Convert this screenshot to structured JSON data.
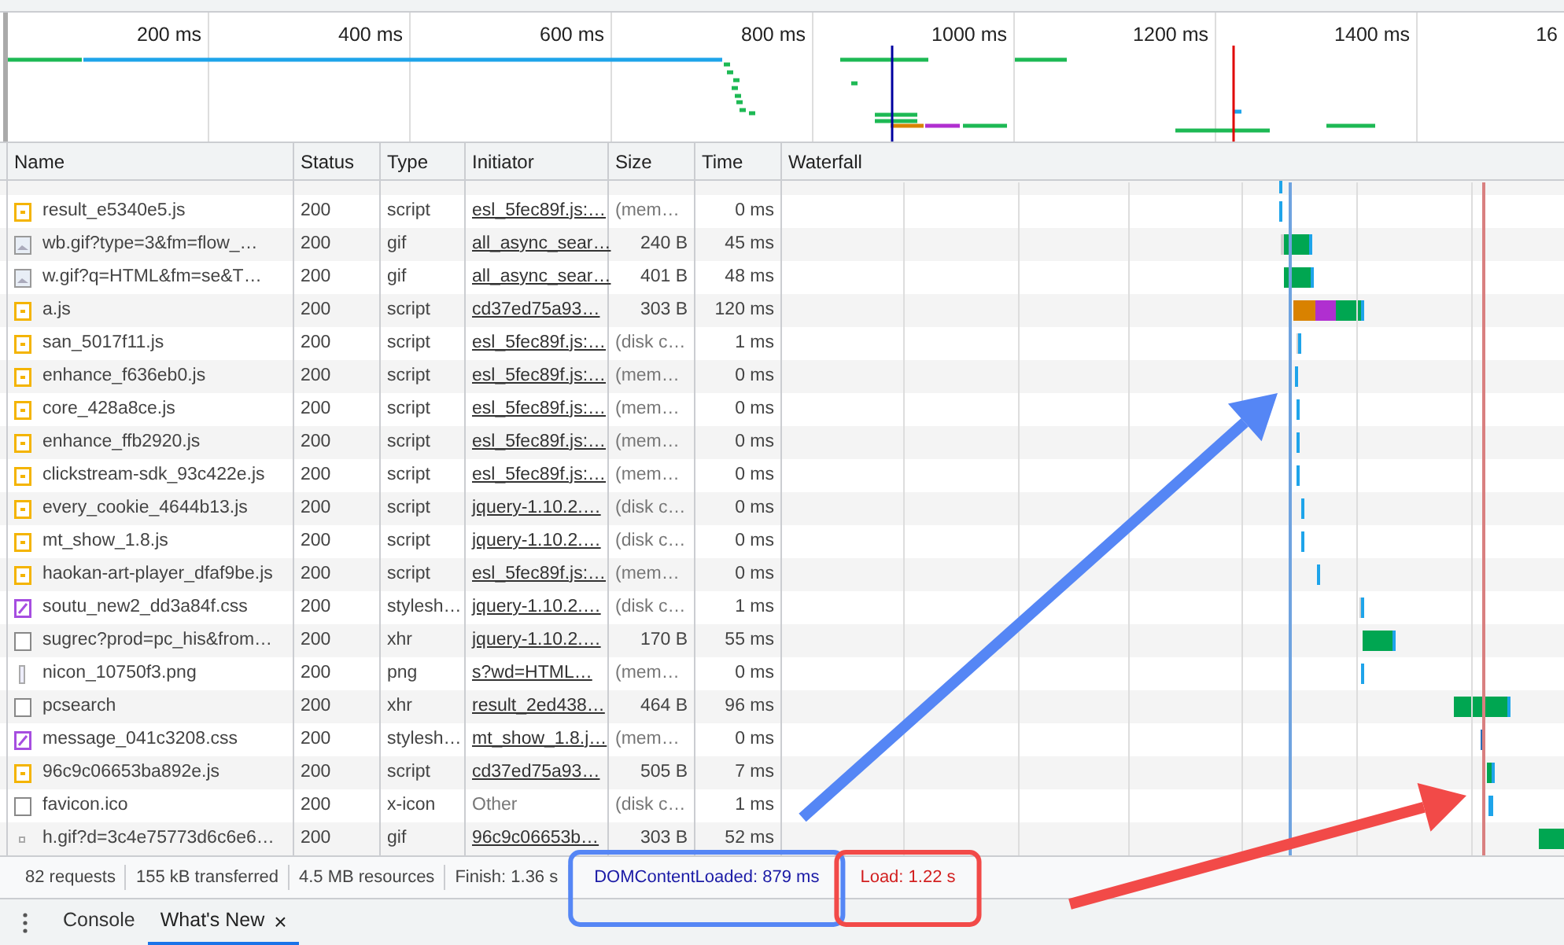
{
  "overview": {
    "ticks": [
      "200 ms",
      "400 ms",
      "600 ms",
      "800 ms",
      "1000 ms",
      "1200 ms",
      "1400 ms",
      "16"
    ]
  },
  "columns": [
    "Name",
    "Status",
    "Type",
    "Initiator",
    "Size",
    "Time",
    "Waterfall"
  ],
  "rows": [
    {
      "kind": "script",
      "name": "result_e5340e5.js",
      "status": "200",
      "type": "script",
      "initiator": "esl_5fec89f.js:…",
      "link": true,
      "size": "(mem…",
      "cached": true,
      "time": "0 ms"
    },
    {
      "kind": "image",
      "name": "wb.gif?type=3&fm=flow_…",
      "status": "200",
      "type": "gif",
      "initiator": "all_async_sear…",
      "link": true,
      "size": "240 B",
      "cached": false,
      "time": "45 ms"
    },
    {
      "kind": "image",
      "name": "w.gif?q=HTML&fm=se&T…",
      "status": "200",
      "type": "gif",
      "initiator": "all_async_sear…",
      "link": true,
      "size": "401 B",
      "cached": false,
      "time": "48 ms"
    },
    {
      "kind": "script",
      "name": "a.js",
      "status": "200",
      "type": "script",
      "initiator": "cd37ed75a93…",
      "link": true,
      "size": "303 B",
      "cached": false,
      "time": "120 ms"
    },
    {
      "kind": "script",
      "name": "san_5017f11.js",
      "status": "200",
      "type": "script",
      "initiator": "esl_5fec89f.js:…",
      "link": true,
      "size": "(disk c…",
      "cached": true,
      "time": "1 ms"
    },
    {
      "kind": "script",
      "name": "enhance_f636eb0.js",
      "status": "200",
      "type": "script",
      "initiator": "esl_5fec89f.js:…",
      "link": true,
      "size": "(mem…",
      "cached": true,
      "time": "0 ms"
    },
    {
      "kind": "script",
      "name": "core_428a8ce.js",
      "status": "200",
      "type": "script",
      "initiator": "esl_5fec89f.js:…",
      "link": true,
      "size": "(mem…",
      "cached": true,
      "time": "0 ms"
    },
    {
      "kind": "script",
      "name": "enhance_ffb2920.js",
      "status": "200",
      "type": "script",
      "initiator": "esl_5fec89f.js:…",
      "link": true,
      "size": "(mem…",
      "cached": true,
      "time": "0 ms"
    },
    {
      "kind": "script",
      "name": "clickstream-sdk_93c422e.js",
      "status": "200",
      "type": "script",
      "initiator": "esl_5fec89f.js:…",
      "link": true,
      "size": "(mem…",
      "cached": true,
      "time": "0 ms"
    },
    {
      "kind": "script",
      "name": "every_cookie_4644b13.js",
      "status": "200",
      "type": "script",
      "initiator": "jquery-1.10.2.…",
      "link": true,
      "size": "(disk c…",
      "cached": true,
      "time": "0 ms"
    },
    {
      "kind": "script",
      "name": "mt_show_1.8.js",
      "status": "200",
      "type": "script",
      "initiator": "jquery-1.10.2.…",
      "link": true,
      "size": "(disk c…",
      "cached": true,
      "time": "0 ms"
    },
    {
      "kind": "script",
      "name": "haokan-art-player_dfaf9be.js",
      "status": "200",
      "type": "script",
      "initiator": "esl_5fec89f.js:…",
      "link": true,
      "size": "(mem…",
      "cached": true,
      "time": "0 ms"
    },
    {
      "kind": "stylesheet",
      "name": "soutu_new2_dd3a84f.css",
      "status": "200",
      "type": "stylesh…",
      "initiator": "jquery-1.10.2.…",
      "link": true,
      "size": "(disk c…",
      "cached": true,
      "time": "1 ms"
    },
    {
      "kind": "document",
      "name": "sugrec?prod=pc_his&from…",
      "status": "200",
      "type": "xhr",
      "initiator": "jquery-1.10.2.…",
      "link": true,
      "size": "170 B",
      "cached": false,
      "time": "55 ms"
    },
    {
      "kind": "thin",
      "name": "nicon_10750f3.png",
      "status": "200",
      "type": "png",
      "initiator": "s?wd=HTML…",
      "link": true,
      "size": "(mem…",
      "cached": true,
      "time": "0 ms"
    },
    {
      "kind": "document",
      "name": "pcsearch",
      "status": "200",
      "type": "xhr",
      "initiator": "result_2ed438…",
      "link": true,
      "size": "464 B",
      "cached": false,
      "time": "96 ms"
    },
    {
      "kind": "stylesheet",
      "name": "message_041c3208.css",
      "status": "200",
      "type": "stylesh…",
      "initiator": "mt_show_1.8.j…",
      "link": true,
      "size": "(mem…",
      "cached": true,
      "time": "0 ms"
    },
    {
      "kind": "script",
      "name": "96c9c06653ba892e.js",
      "status": "200",
      "type": "script",
      "initiator": "cd37ed75a93…",
      "link": true,
      "size": "505 B",
      "cached": false,
      "time": "7 ms"
    },
    {
      "kind": "document",
      "name": "favicon.ico",
      "status": "200",
      "type": "x-icon",
      "initiator": "Other",
      "link": false,
      "size": "(disk c…",
      "cached": true,
      "time": "1 ms"
    },
    {
      "kind": "dot",
      "name": "h.gif?d=3c4e75773d6c6e6…",
      "status": "200",
      "type": "gif",
      "initiator": "96c9c06653b…",
      "link": true,
      "size": "303 B",
      "cached": false,
      "time": "52 ms"
    }
  ],
  "summary": [
    {
      "text": "82 requests",
      "kind": "plain"
    },
    {
      "text": "155 kB transferred",
      "kind": "plain"
    },
    {
      "text": "4.5 MB resources",
      "kind": "plain"
    },
    {
      "text": "Finish: 1.36 s",
      "kind": "plain"
    },
    {
      "text": "DOMContentLoaded: 879 ms",
      "kind": "dcl"
    },
    {
      "text": "Load: 1.22 s",
      "kind": "load"
    }
  ],
  "drawer": {
    "tabs": [
      {
        "label": "Console",
        "selected": false
      },
      {
        "label": "What's New",
        "selected": true,
        "close": "×"
      }
    ]
  }
}
